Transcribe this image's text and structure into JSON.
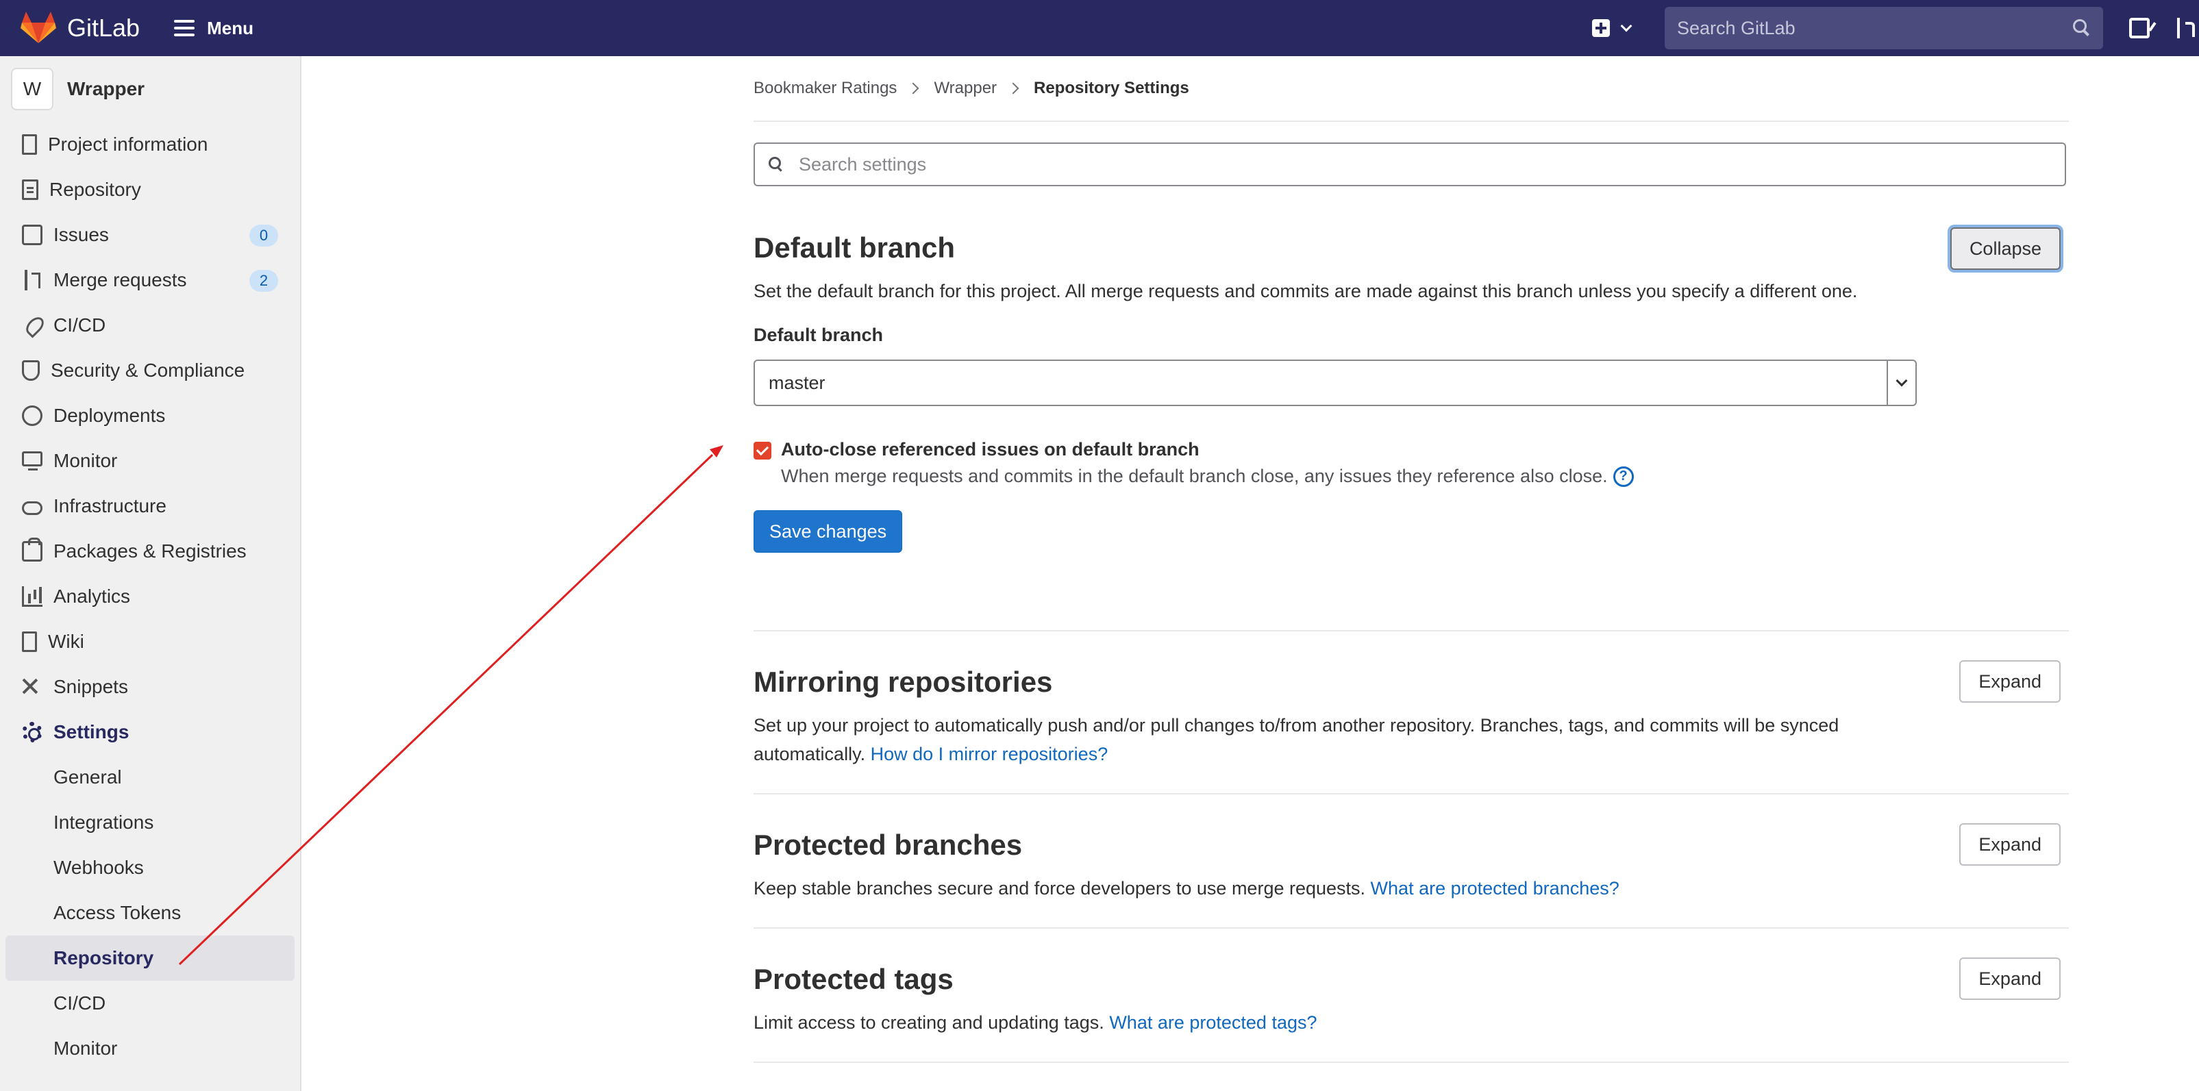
{
  "navbar": {
    "brand": "GitLab",
    "menu_label": "Menu",
    "search_placeholder": "Search GitLab"
  },
  "sidebar": {
    "project_initial": "W",
    "project_name": "Wrapper",
    "items": [
      {
        "label": "Project information",
        "icon": "project-info-icon"
      },
      {
        "label": "Repository",
        "icon": "repository-icon"
      },
      {
        "label": "Issues",
        "icon": "issues-icon",
        "count": "0"
      },
      {
        "label": "Merge requests",
        "icon": "merge-request-icon",
        "count": "2"
      },
      {
        "label": "CI/CD",
        "icon": "rocket-icon"
      },
      {
        "label": "Security & Compliance",
        "icon": "shield-icon"
      },
      {
        "label": "Deployments",
        "icon": "deployments-icon"
      },
      {
        "label": "Monitor",
        "icon": "monitor-icon"
      },
      {
        "label": "Infrastructure",
        "icon": "cloud-icon"
      },
      {
        "label": "Packages & Registries",
        "icon": "package-icon"
      },
      {
        "label": "Analytics",
        "icon": "analytics-icon"
      },
      {
        "label": "Wiki",
        "icon": "book-icon"
      },
      {
        "label": "Snippets",
        "icon": "scissors-icon"
      },
      {
        "label": "Settings",
        "icon": "gear-icon"
      }
    ],
    "settings_sub": [
      "General",
      "Integrations",
      "Webhooks",
      "Access Tokens",
      "Repository",
      "CI/CD",
      "Monitor"
    ]
  },
  "breadcrumb": [
    "Bookmaker Ratings",
    "Wrapper",
    "Repository Settings"
  ],
  "settings_search_placeholder": "Search settings",
  "sections": {
    "default_branch": {
      "title": "Default branch",
      "toggle": "Collapse",
      "description": "Set the default branch for this project. All merge requests and commits are made against this branch unless you specify a different one.",
      "field_label": "Default branch",
      "selected_branch": "master",
      "checkbox_label": "Auto-close referenced issues on default branch",
      "checkbox_checked": true,
      "checkbox_help": "When merge requests and commits in the default branch close, any issues they reference also close.",
      "save_label": "Save changes"
    },
    "mirroring": {
      "title": "Mirroring repositories",
      "toggle": "Expand",
      "description": "Set up your project to automatically push and/or pull changes to/from another repository. Branches, tags, and commits will be synced automatically.",
      "link": "How do I mirror repositories?"
    },
    "protected_branches": {
      "title": "Protected branches",
      "toggle": "Expand",
      "description": "Keep stable branches secure and force developers to use merge requests.",
      "link": "What are protected branches?"
    },
    "protected_tags": {
      "title": "Protected tags",
      "toggle": "Expand",
      "description": "Limit access to creating and updating tags.",
      "link": "What are protected tags?"
    }
  },
  "colors": {
    "navbar_bg": "#292961",
    "primary_button": "#1f75cb",
    "link": "#1068bf",
    "checkbox": "#e24329",
    "annotation_arrow": "#e02020"
  }
}
